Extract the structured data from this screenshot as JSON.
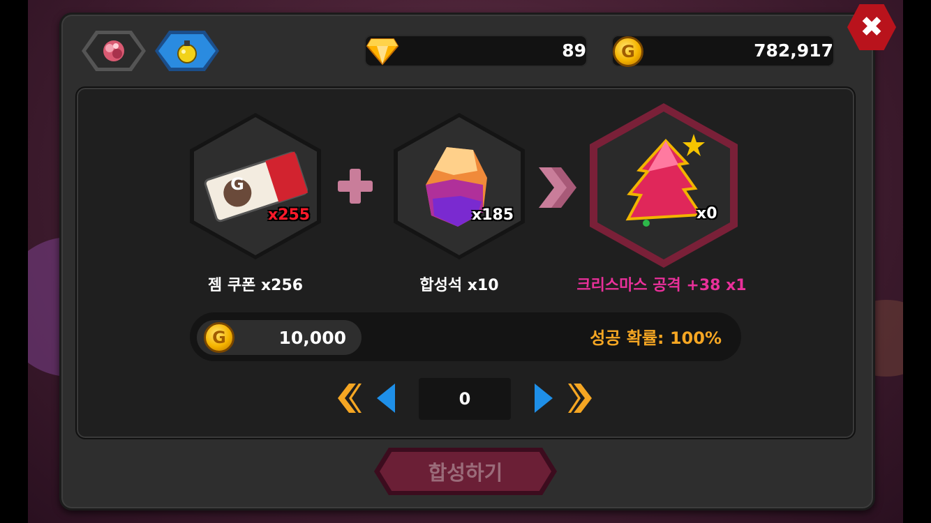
{
  "tabs": [
    {
      "icon": "red-gem-icon",
      "active": false
    },
    {
      "icon": "gold-potion-icon",
      "active": true
    }
  ],
  "currency": {
    "diamonds": "89",
    "gold": "782,917"
  },
  "recipe": {
    "ingredient1": {
      "name": "젬 쿠폰 x256",
      "qty": "x255",
      "icon": "gem-coupon-icon",
      "coupon_letter": "G"
    },
    "ingredient2": {
      "name": "합성석 x10",
      "qty": "x185",
      "icon": "synthesis-stone-icon"
    },
    "result": {
      "name": "크리스마스 공격 +38 x1",
      "qty": "x0",
      "icon": "christmas-tree-gem-icon"
    }
  },
  "cost": {
    "coin_letter": "G",
    "amount": "10,000",
    "success_rate": "성공 확률: 100%"
  },
  "quantity": {
    "value": "0"
  },
  "combine_button": "합성하기",
  "close_label": "✖",
  "colors": {
    "result_label": "#e9309a",
    "success_rate": "#f5a623",
    "gold": "#f5b400",
    "active_tab": "#2a8be0"
  }
}
